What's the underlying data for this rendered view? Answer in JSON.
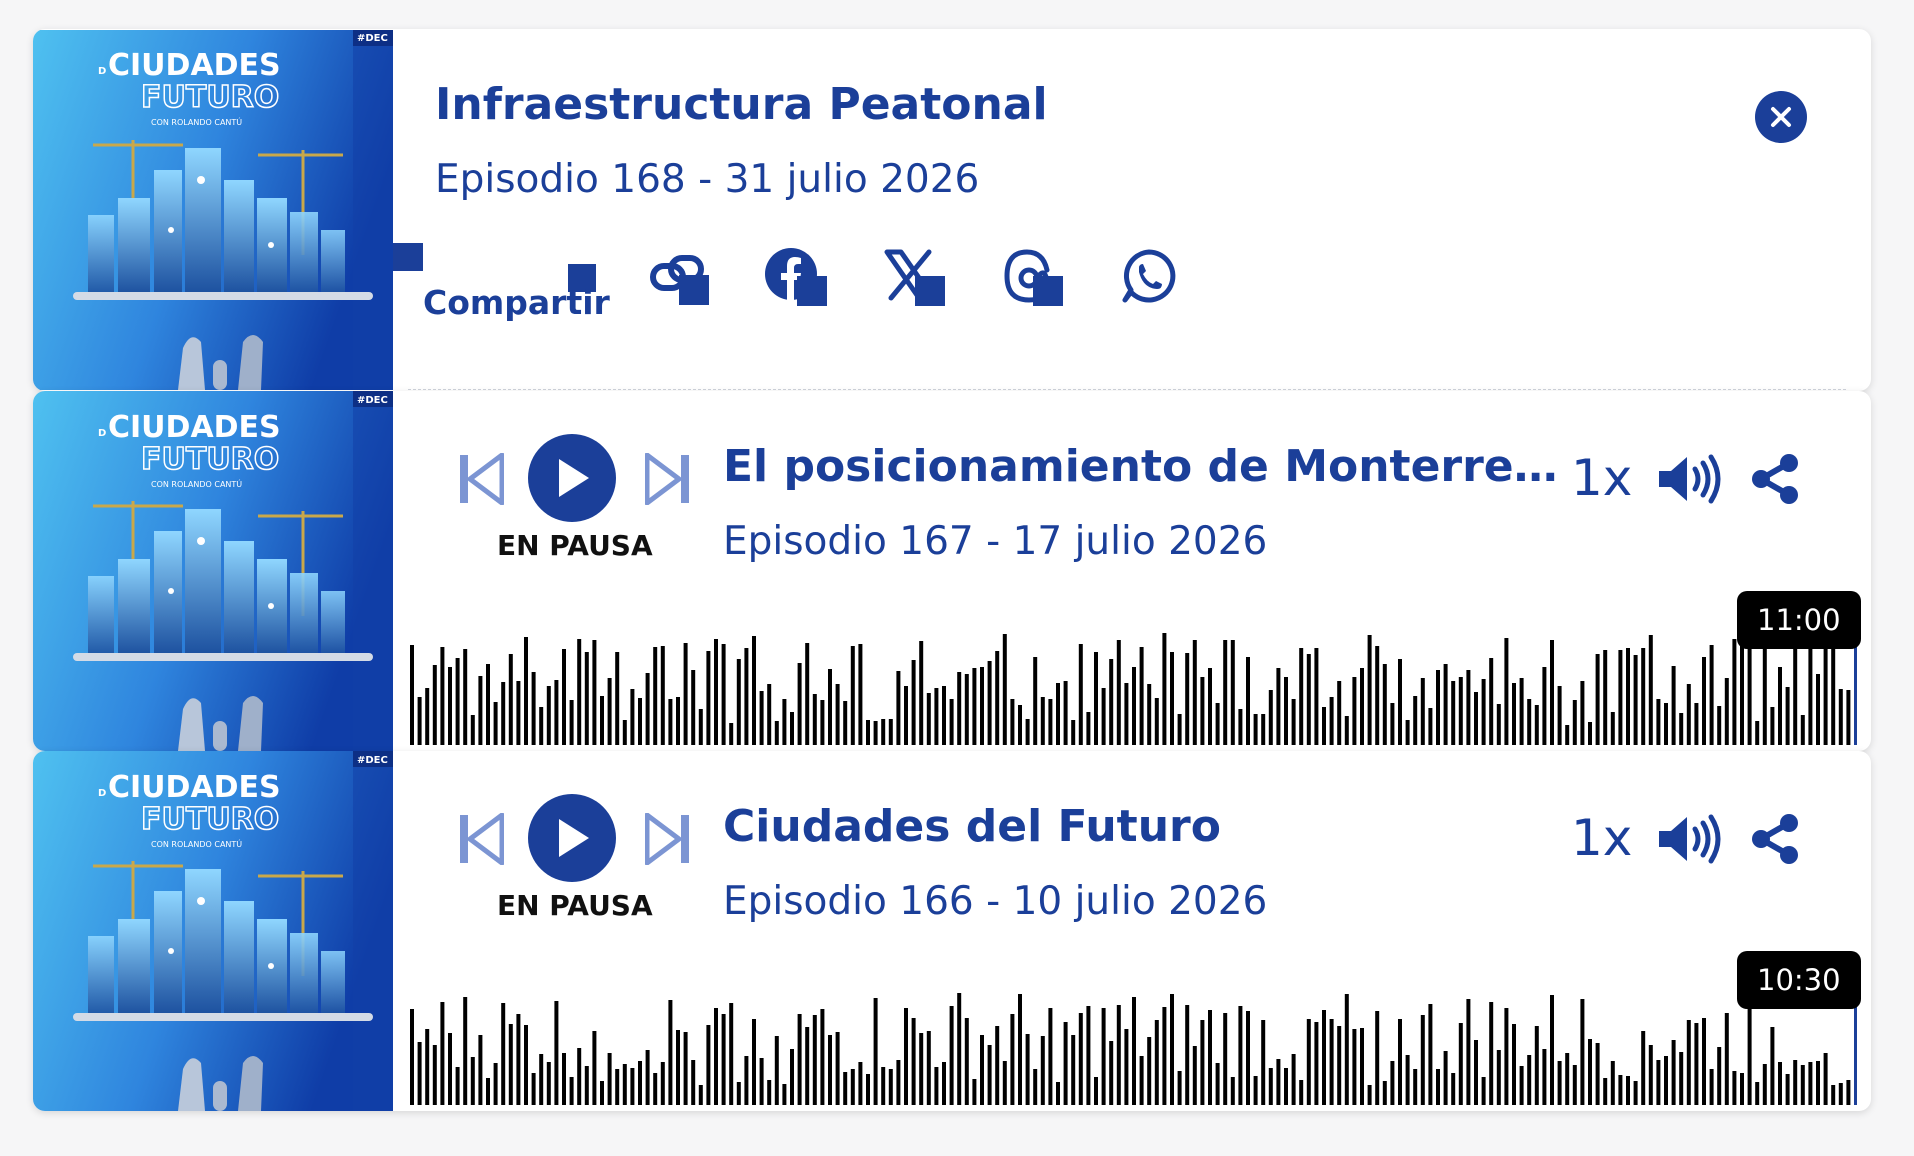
{
  "podcast": {
    "cover_title_line1": "CIUDADES",
    "cover_title_line2": "FUTURO",
    "cover_prefix": "D",
    "cover_host": "CON ROLANDO CANTÚ",
    "cover_tag": "#DEC"
  },
  "share_panel": {
    "title": "Infraestructura Peatonal",
    "subtitle": "Episodio 168 - 31 julio 2026",
    "share_label": "Compartir",
    "close_icon": "close-icon",
    "social_icons": [
      "link-icon",
      "facebook-icon",
      "x-icon",
      "threads-icon",
      "whatsapp-icon"
    ]
  },
  "episodes": [
    {
      "title": "El posicionamiento de Monterrey ...",
      "subtitle": "Episodio 167 - 17 julio 2026",
      "status": "EN PAUSA",
      "speed": "1x",
      "duration": "11:00"
    },
    {
      "title": "Ciudades del Futuro",
      "subtitle": "Episodio 166 - 10 julio 2026",
      "status": "EN PAUSA",
      "speed": "1x",
      "duration": "10:30"
    }
  ],
  "colors": {
    "primary": "#1b3f99",
    "secondary": "#7c95d3",
    "waveform": "#000000",
    "cover_light": "#4fc1f0",
    "cover_dark": "#0f3da7"
  }
}
